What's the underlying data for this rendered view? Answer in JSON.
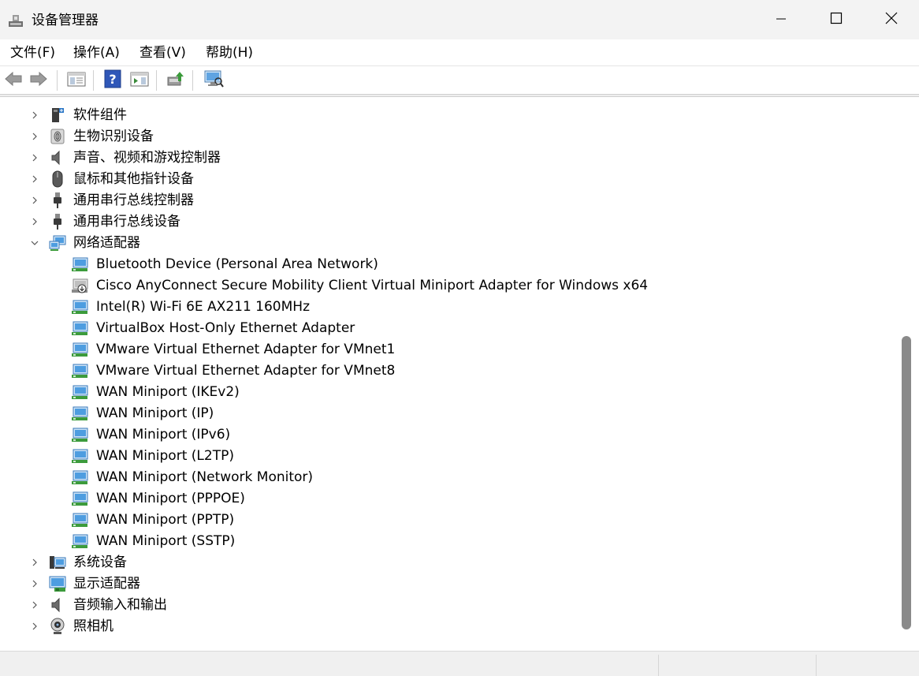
{
  "window": {
    "title": "设备管理器",
    "controls": [
      "minimize",
      "maximize",
      "close"
    ]
  },
  "menu": {
    "file": "文件(F)",
    "action": "操作(A)",
    "view": "查看(V)",
    "help": "帮助(H)"
  },
  "toolbar": {
    "icons": [
      "back-arrow-icon",
      "forward-arrow-icon",
      "show-hide-console-tree-icon",
      "help-icon",
      "properties-icon",
      "update-driver-icon",
      "scan-hardware-icon"
    ]
  },
  "tree": {
    "categories_before": [
      {
        "label": "软件组件",
        "icon": "software-component-icon"
      },
      {
        "label": "生物识别设备",
        "icon": "biometric-icon"
      },
      {
        "label": "声音、视频和游戏控制器",
        "icon": "speaker-icon"
      },
      {
        "label": "鼠标和其他指针设备",
        "icon": "mouse-icon"
      },
      {
        "label": "通用串行总线控制器",
        "icon": "usb-icon"
      },
      {
        "label": "通用串行总线设备",
        "icon": "usb-icon"
      }
    ],
    "network": {
      "label": "网络适配器",
      "icon": "network-adapter-icon",
      "expanded": true,
      "children": [
        {
          "label": "Bluetooth Device (Personal Area Network)",
          "icon": "network-adapter-icon"
        },
        {
          "label": "Cisco AnyConnect Secure Mobility Client Virtual Miniport Adapter for Windows x64",
          "icon": "network-adapter-disabled-icon"
        },
        {
          "label": "Intel(R) Wi-Fi 6E AX211 160MHz",
          "icon": "network-adapter-icon"
        },
        {
          "label": "VirtualBox Host-Only Ethernet Adapter",
          "icon": "network-adapter-icon"
        },
        {
          "label": "VMware Virtual Ethernet Adapter for VMnet1",
          "icon": "network-adapter-icon"
        },
        {
          "label": "VMware Virtual Ethernet Adapter for VMnet8",
          "icon": "network-adapter-icon"
        },
        {
          "label": "WAN Miniport (IKEv2)",
          "icon": "network-adapter-icon"
        },
        {
          "label": "WAN Miniport (IP)",
          "icon": "network-adapter-icon"
        },
        {
          "label": "WAN Miniport (IPv6)",
          "icon": "network-adapter-icon"
        },
        {
          "label": "WAN Miniport (L2TP)",
          "icon": "network-adapter-icon"
        },
        {
          "label": "WAN Miniport (Network Monitor)",
          "icon": "network-adapter-icon"
        },
        {
          "label": "WAN Miniport (PPPOE)",
          "icon": "network-adapter-icon"
        },
        {
          "label": "WAN Miniport (PPTP)",
          "icon": "network-adapter-icon"
        },
        {
          "label": "WAN Miniport (SSTP)",
          "icon": "network-adapter-icon"
        }
      ]
    },
    "categories_after": [
      {
        "label": "系统设备",
        "icon": "system-device-icon"
      },
      {
        "label": "显示适配器",
        "icon": "display-adapter-icon"
      },
      {
        "label": "音频输入和输出",
        "icon": "speaker-icon"
      },
      {
        "label": "照相机",
        "icon": "camera-icon"
      }
    ]
  },
  "colors": {
    "accent_blue": "#2b7fd6",
    "network_green": "#3c9b3c"
  }
}
